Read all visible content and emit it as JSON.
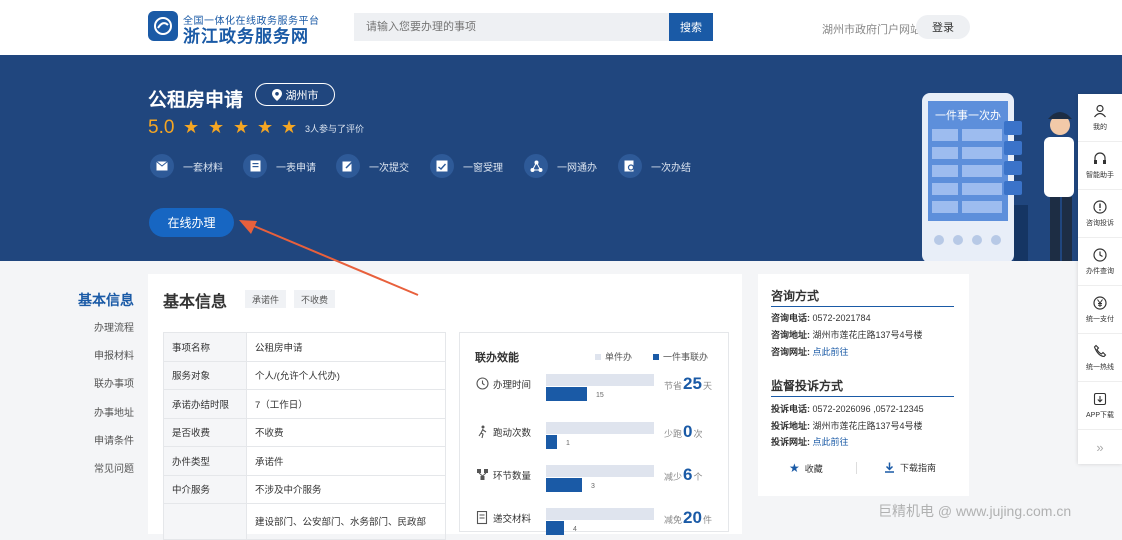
{
  "header": {
    "logo_sub": "全国一体化在线政务服务平台",
    "logo_main": "浙江政务服务网",
    "search_placeholder": "请输入您要办理的事项",
    "search_button": "搜索",
    "gov_portal": "湖州市政府门户网站",
    "login": "登录"
  },
  "banner": {
    "title": "公租房申请",
    "location": "湖州市",
    "rating": "5.0",
    "stars": 5,
    "rating_count": "3人参与了评价",
    "features": [
      {
        "icon": "envelope-icon",
        "label": "一套材料"
      },
      {
        "icon": "form-icon",
        "label": "一表申请"
      },
      {
        "icon": "edit-icon",
        "label": "一次提交"
      },
      {
        "icon": "inbox-icon",
        "label": "一窗受理"
      },
      {
        "icon": "network-icon",
        "label": "一网通办"
      },
      {
        "icon": "document-search-icon",
        "label": "一次办结"
      }
    ],
    "online_button": "在线办理",
    "illustration_text": "一件事一次办"
  },
  "rail": [
    {
      "icon": "user-icon",
      "label": "我的"
    },
    {
      "icon": "headset-icon",
      "label": "智能助手"
    },
    {
      "icon": "warning-icon",
      "label": "咨询投诉"
    },
    {
      "icon": "history-icon",
      "label": "办件查询"
    },
    {
      "icon": "yen-icon",
      "label": "统一支付"
    },
    {
      "icon": "phone-icon",
      "label": "统一热线"
    },
    {
      "icon": "download-icon",
      "label": "APP下载"
    }
  ],
  "nav": {
    "title": "基本信息",
    "items": [
      "办理流程",
      "申报材料",
      "联办事项",
      "办事地址",
      "申请条件",
      "常见问题"
    ]
  },
  "info": {
    "title": "基本信息",
    "tags": [
      "承诺件",
      "不收费"
    ],
    "rows": [
      {
        "k": "事项名称",
        "v": "公租房申请"
      },
      {
        "k": "服务对象",
        "v": "个人/(允许个人代办)"
      },
      {
        "k": "承诺办结时限",
        "v": "7（工作日）"
      },
      {
        "k": "是否收费",
        "v": "不收费"
      },
      {
        "k": "办件类型",
        "v": "承诺件"
      },
      {
        "k": "中介服务",
        "v": "不涉及中介服务"
      },
      {
        "k": "",
        "v": "建设部门、公安部门、水务部门、民政部"
      }
    ]
  },
  "efficiency": {
    "title": "联办效能",
    "legend_single": "单件办",
    "legend_joint": "一件事联办",
    "colors": {
      "single": "#dfe4ee",
      "joint": "#1a5aa6"
    },
    "metrics": [
      {
        "icon": "clock-icon",
        "label": "办理时间",
        "single_max": 1.0,
        "joint_ratio": 0.375,
        "value": "15",
        "saving_prefix": "节省",
        "saving": "25",
        "unit": "天"
      },
      {
        "icon": "walk-icon",
        "label": "跑动次数",
        "single_max": 1.0,
        "joint_ratio": 0.1,
        "value": "1",
        "saving_prefix": "少跑",
        "saving": "0",
        "unit": "次"
      },
      {
        "icon": "nodes-icon",
        "label": "环节数量",
        "single_max": 1.0,
        "joint_ratio": 0.33,
        "value": "3",
        "saving_prefix": "减少",
        "saving": "6",
        "unit": "个"
      },
      {
        "icon": "file-icon",
        "label": "递交材料",
        "single_max": 1.0,
        "joint_ratio": 0.17,
        "value": "4",
        "saving_prefix": "减免",
        "saving": "20",
        "unit": "件"
      }
    ]
  },
  "consult": {
    "title": "咨询方式",
    "phone_k": "咨询电话:",
    "phone_v": "0572-2021784",
    "addr_k": "咨询地址:",
    "addr_v": "湖州市莲花庄路137号4号楼",
    "web_k": "咨询网址:",
    "web_v": "点此前往"
  },
  "complaint": {
    "title": "监督投诉方式",
    "phone_k": "投诉电话:",
    "phone_v": "0572-2026096 ,0572-12345",
    "addr_k": "投诉地址:",
    "addr_v": "湖州市莲花庄路137号4号楼",
    "web_k": "投诉网址:",
    "web_v": "点此前往"
  },
  "actions": {
    "favorite": "收藏",
    "guide": "下载指南"
  },
  "watermark": "巨精机电 @ www.jujing.com.cn"
}
